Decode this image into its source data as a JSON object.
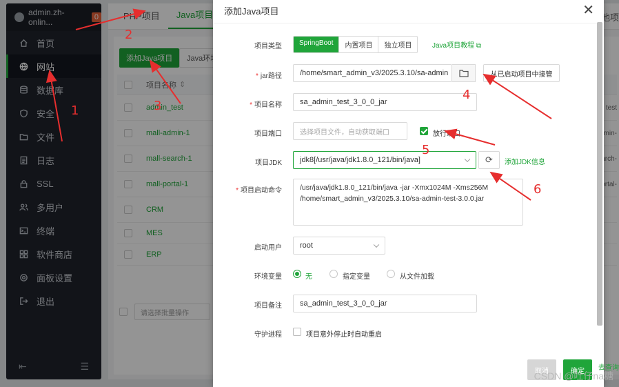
{
  "sidebar": {
    "host": "admin.zh-onlin...",
    "badge": "0",
    "items": [
      {
        "label": "首页",
        "icon": "home-icon"
      },
      {
        "label": "网站",
        "icon": "globe-icon"
      },
      {
        "label": "数据库",
        "icon": "database-icon"
      },
      {
        "label": "安全",
        "icon": "shield-icon"
      },
      {
        "label": "文件",
        "icon": "folder-icon"
      },
      {
        "label": "日志",
        "icon": "log-icon"
      },
      {
        "label": "SSL",
        "icon": "ssl-icon"
      },
      {
        "label": "多用户",
        "icon": "users-icon"
      },
      {
        "label": "终端",
        "icon": "terminal-icon"
      },
      {
        "label": "软件商店",
        "icon": "store-icon"
      },
      {
        "label": "面板设置",
        "icon": "gear-icon"
      },
      {
        "label": "退出",
        "icon": "logout-icon"
      }
    ],
    "active_index": 1
  },
  "background": {
    "tabs": [
      "PHP项目",
      "Java项目"
    ],
    "tab_right": "他项",
    "add_button": "添加Java项目",
    "env_button": "Java环境",
    "table_header": "项目名称",
    "rows": [
      "admin_test",
      "mall-admin-1",
      "mall-search-1",
      "mall-portal-1",
      "CRM",
      "MES",
      "ERP"
    ],
    "right_col": [
      "test",
      "dmin-",
      "arch-",
      "ortal-"
    ],
    "batch_placeholder": "请选择批量操作"
  },
  "dialog": {
    "title": "添加Java项目",
    "project_type": {
      "label": "项目类型",
      "options": [
        "SpringBoot",
        "内置项目",
        "独立项目"
      ],
      "selected": "SpringBoot",
      "tutorial_link": "Java项目教程"
    },
    "jar_path": {
      "label": "jar路径",
      "value": "/home/smart_admin_v3/2025.3.10/sa-admin",
      "takeover_button": "从已启动项目中接管"
    },
    "project_name": {
      "label": "项目名称",
      "value": "sa_admin_test_3_0_0_jar"
    },
    "project_port": {
      "label": "项目端口",
      "placeholder": "选择项目文件，自动获取端口",
      "release_label": "放行端口",
      "release_checked": true
    },
    "jdk": {
      "label": "项目JDK",
      "value": "jdk8[/usr/java/jdk1.8.0_121/bin/java]",
      "add_link": "添加JDK信息"
    },
    "start_cmd": {
      "label": "项目启动命令",
      "lines": [
        "/usr/java/jdk1.8.0_121/bin/java -jar -Xmx1024M -Xms256M",
        "/home/smart_admin_v3/2025.3.10/sa-admin-test-3.0.0.jar"
      ]
    },
    "start_user": {
      "label": "启动用户",
      "value": "root"
    },
    "env_vars": {
      "label": "环境变量",
      "options": [
        "无",
        "指定变量",
        "从文件加载"
      ],
      "selected": "无"
    },
    "remark": {
      "label": "项目备注",
      "value": "sa_admin_test_3_0_0_jar"
    },
    "daemon": {
      "label": "守护进程",
      "text": "项目意外停止时自动重启",
      "checked": false
    },
    "cancel_button": "取消",
    "confirm_button": "确定"
  },
  "right_side_text": "去查询",
  "annotations": [
    "1",
    "2",
    "3",
    "4",
    "5",
    "6"
  ],
  "watermark": "CSDN @吐仔na糖",
  "colors": {
    "accent": "#20a53a",
    "sidebar": "#20242c",
    "annotation": "#e62e2e"
  }
}
